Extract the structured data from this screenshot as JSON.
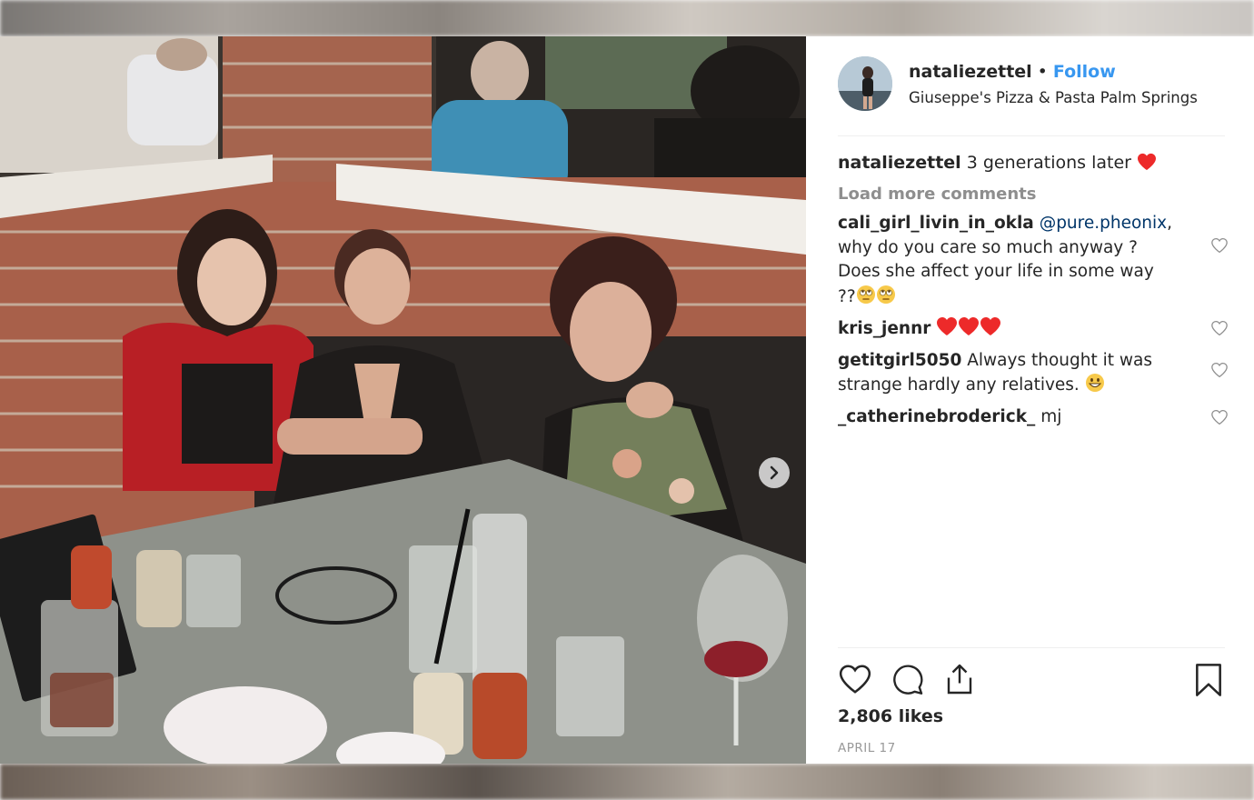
{
  "post": {
    "username": "nataliezettel",
    "separator": "•",
    "follow_label": "Follow",
    "location": "Giuseppe's Pizza & Pasta Palm Springs"
  },
  "caption": {
    "username": "nataliezettel",
    "text": "3 generations later",
    "emoji": "red-heart"
  },
  "load_more_label": "Load more comments",
  "comments": [
    {
      "username": "cali_girl_livin_in_okla",
      "mention": "@pure.pheonix",
      "text": ", why do you care so much anyway ? Does she affect your life in some way ??",
      "emojis": [
        "face-with-rolling-eyes",
        "face-with-rolling-eyes"
      ]
    },
    {
      "username": "kris_jennr",
      "text": "",
      "emojis": [
        "red-heart",
        "red-heart",
        "red-heart"
      ]
    },
    {
      "username": "getitgirl5050",
      "text": "Always thought it was strange hardly any relatives.",
      "emojis": [
        "grinning-face"
      ]
    },
    {
      "username": "_catherinebroderick_",
      "text": "mj",
      "emojis": []
    }
  ],
  "actions": {
    "like_icon": "heart-outline-icon",
    "comment_icon": "comment-bubble-icon",
    "share_icon": "share-upload-icon",
    "save_icon": "bookmark-icon"
  },
  "likes_label": "2,806 likes",
  "date_label": "APRIL 17",
  "colors": {
    "follow": "#3897f0",
    "mention": "#003569",
    "muted": "#8e8e8e",
    "heart": "#ed2a2a"
  }
}
